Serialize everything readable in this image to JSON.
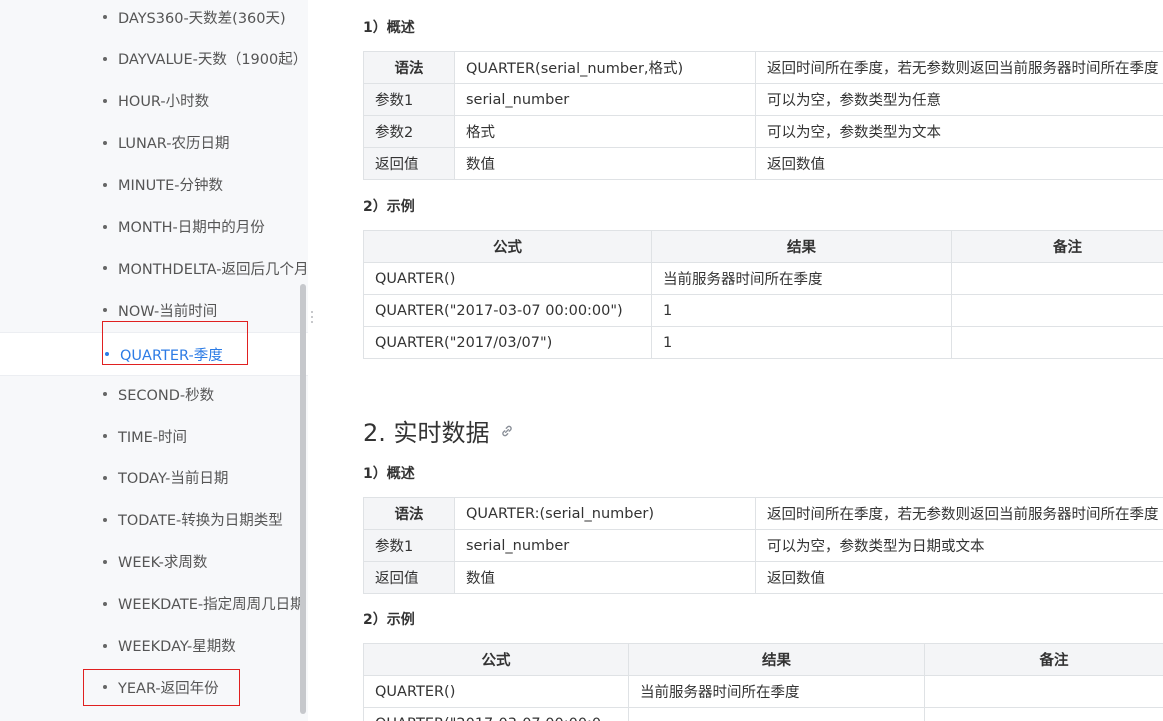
{
  "sidebar": {
    "items": [
      {
        "label": "DAYS360-天数差(360天)"
      },
      {
        "label": "DAYVALUE-天数（1900起）"
      },
      {
        "label": "HOUR-小时数"
      },
      {
        "label": "LUNAR-农历日期"
      },
      {
        "label": "MINUTE-分钟数"
      },
      {
        "label": "MONTH-日期中的月份"
      },
      {
        "label": "MONTHDELTA-返回后几个月"
      },
      {
        "label": "NOW-当前时间"
      },
      {
        "label": "QUARTER-季度",
        "active": true
      },
      {
        "label": "SECOND-秒数"
      },
      {
        "label": "TIME-时间"
      },
      {
        "label": "TODAY-当前日期"
      },
      {
        "label": "TODATE-转换为日期类型"
      },
      {
        "label": "WEEK-求周数"
      },
      {
        "label": "WEEKDATE-指定周周几日期"
      },
      {
        "label": "WEEKDAY-星期数"
      },
      {
        "label": "YEAR-返回年份"
      }
    ],
    "active_color": "#2c7be5",
    "highlight_color": "#e02020"
  },
  "section1": {
    "overview_heading": "1）概述",
    "syntax_rows": [
      [
        "语法",
        "QUARTER(serial_number,格式)",
        "返回时间所在季度，若无参数则返回当前服务器时间所在季度"
      ],
      [
        "参数1",
        "serial_number",
        "可以为空，参数类型为任意"
      ],
      [
        "参数2",
        "格式",
        "可以为空，参数类型为文本"
      ],
      [
        "返回值",
        "数值",
        "返回数值"
      ]
    ],
    "example_heading": "2）示例",
    "example_headers": [
      "公式",
      "结果",
      "备注"
    ],
    "example_rows": [
      [
        "QUARTER()",
        "当前服务器时间所在季度",
        ""
      ],
      [
        "QUARTER(\"2017-03-07 00:00:00\")",
        "1",
        ""
      ],
      [
        "QUARTER(\"2017/03/07\")",
        "1",
        ""
      ]
    ]
  },
  "section2": {
    "title": "2. 实时数据",
    "link_icon": "link-icon",
    "overview_heading": "1）概述",
    "syntax_rows": [
      [
        "语法",
        "QUARTER:(serial_number)",
        "返回时间所在季度，若无参数则返回当前服务器时间所在季度"
      ],
      [
        "参数1",
        "serial_number",
        "可以为空，参数类型为日期或文本"
      ],
      [
        "返回值",
        "数值",
        "返回数值"
      ]
    ],
    "example_heading": "2）示例",
    "example_headers": [
      "公式",
      "结果",
      "备注"
    ],
    "example_rows": [
      [
        "QUARTER()",
        "当前服务器时间所在季度",
        ""
      ],
      [
        "QUARTER(\"2017-03-07 00:00:0",
        "",
        ""
      ]
    ]
  }
}
